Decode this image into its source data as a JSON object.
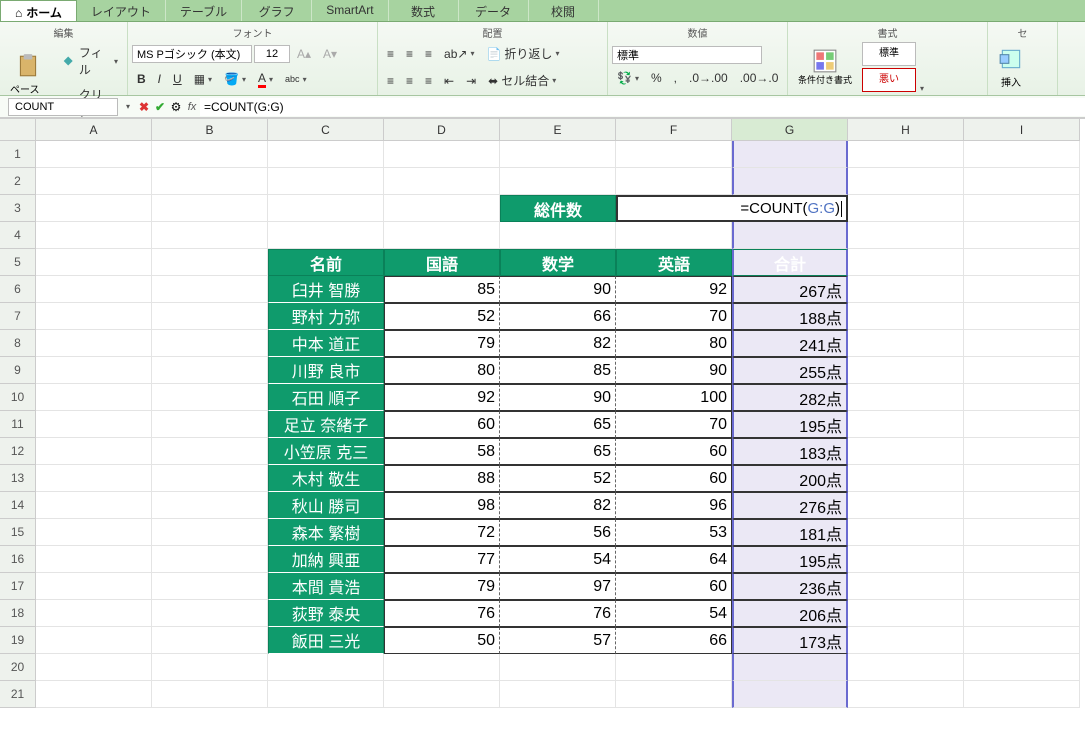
{
  "ribbon": {
    "tabs": [
      "ホーム",
      "レイアウト",
      "テーブル",
      "グラフ",
      "SmartArt",
      "数式",
      "データ",
      "校閲"
    ],
    "active_tab": 0,
    "groups": {
      "edit": {
        "label": "編集",
        "fill": "フィル",
        "clear": "クリア",
        "paste": "ペースト"
      },
      "font": {
        "label": "フォント",
        "name": "MS Pゴシック (本文)",
        "size": "12"
      },
      "align": {
        "label": "配置",
        "wrap": "折り返し",
        "merge": "セル結合"
      },
      "number": {
        "label": "数値",
        "format": "標準"
      },
      "styles": {
        "label": "書式",
        "cond": "条件付き書式",
        "normal": "標準",
        "bad": "悪い"
      },
      "cells": {
        "label": "セ",
        "insert": "挿入"
      }
    }
  },
  "formula_bar": {
    "name_box": "COUNT",
    "formula": "=COUNT(G:G)"
  },
  "columns": [
    "A",
    "B",
    "C",
    "D",
    "E",
    "F",
    "G",
    "H",
    "I"
  ],
  "rows": [
    1,
    2,
    3,
    4,
    5,
    6,
    7,
    8,
    9,
    10,
    11,
    12,
    13,
    14,
    15,
    16,
    17,
    18,
    19,
    20,
    21
  ],
  "cell_E3": "総件数",
  "cell_F3_inline": "=COUNT(",
  "cell_F3_ref": "G:G",
  "cell_F3_close": ")",
  "headers": {
    "C5": "名前",
    "D5": "国語",
    "E5": "数学",
    "F5": "英語",
    "G5": "合計"
  },
  "students": [
    {
      "name": "臼井 智勝",
      "jp": 85,
      "math": 90,
      "en": 92,
      "total": "267点"
    },
    {
      "name": "野村 力弥",
      "jp": 52,
      "math": 66,
      "en": 70,
      "total": "188点"
    },
    {
      "name": "中本 道正",
      "jp": 79,
      "math": 82,
      "en": 80,
      "total": "241点"
    },
    {
      "name": "川野 良市",
      "jp": 80,
      "math": 85,
      "en": 90,
      "total": "255点"
    },
    {
      "name": "石田 順子",
      "jp": 92,
      "math": 90,
      "en": 100,
      "total": "282点"
    },
    {
      "name": "足立 奈緒子",
      "jp": 60,
      "math": 65,
      "en": 70,
      "total": "195点"
    },
    {
      "name": "小笠原 克三",
      "jp": 58,
      "math": 65,
      "en": 60,
      "total": "183点"
    },
    {
      "name": "木村 敬生",
      "jp": 88,
      "math": 52,
      "en": 60,
      "total": "200点"
    },
    {
      "name": "秋山 勝司",
      "jp": 98,
      "math": 82,
      "en": 96,
      "total": "276点"
    },
    {
      "name": "森本 繁樹",
      "jp": 72,
      "math": 56,
      "en": 53,
      "total": "181点"
    },
    {
      "name": "加納 興亜",
      "jp": 77,
      "math": 54,
      "en": 64,
      "total": "195点"
    },
    {
      "name": "本間 貴浩",
      "jp": 79,
      "math": 97,
      "en": 60,
      "total": "236点"
    },
    {
      "name": "荻野 泰央",
      "jp": 76,
      "math": 76,
      "en": 54,
      "total": "206点"
    },
    {
      "name": "飯田 三光",
      "jp": 50,
      "math": 57,
      "en": 66,
      "total": "173点"
    }
  ]
}
